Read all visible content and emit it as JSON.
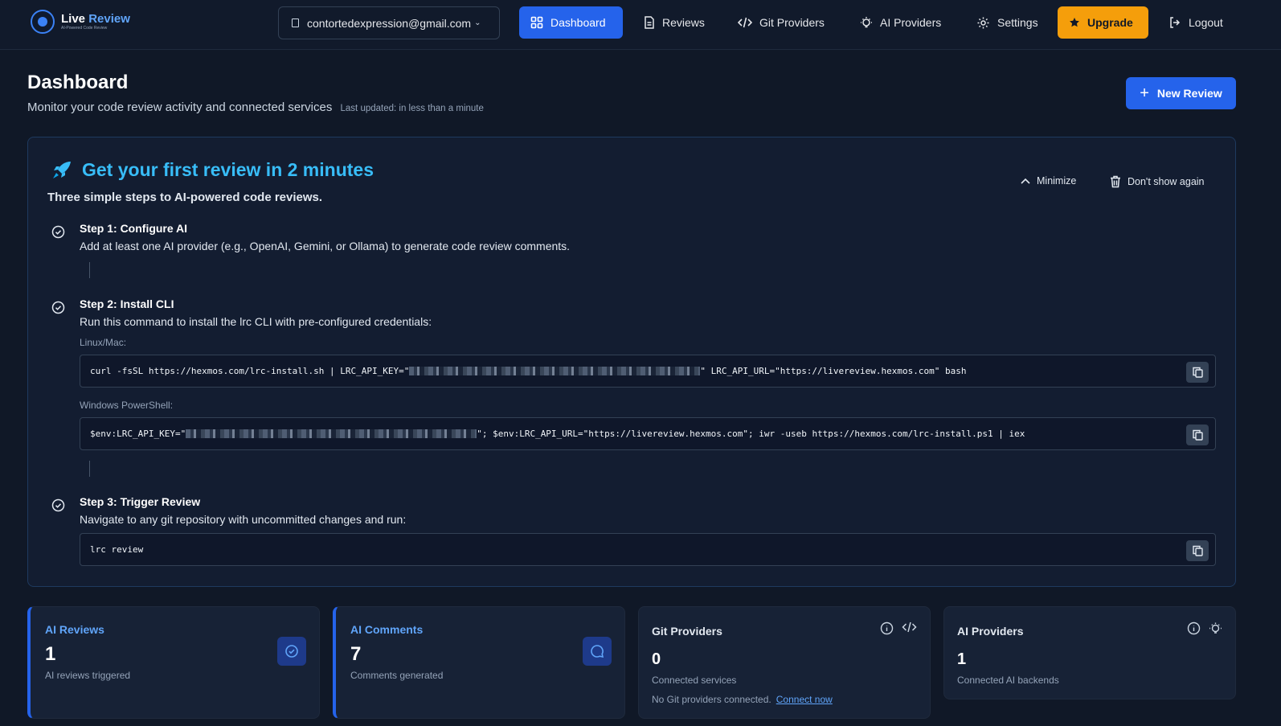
{
  "app": {
    "logo_word1": "Live",
    "logo_word2": "Review",
    "logo_tagline": "AI-Powered Code Review"
  },
  "account": {
    "email": "contortedexpression@gmail.com"
  },
  "nav": {
    "dashboard": "Dashboard",
    "reviews": "Reviews",
    "git_providers": "Git Providers",
    "ai_providers": "AI Providers",
    "settings": "Settings",
    "upgrade": "Upgrade",
    "logout": "Logout"
  },
  "header": {
    "title": "Dashboard",
    "subtitle": "Monitor your code review activity and connected services",
    "last_updated": "Last updated: in less than a minute",
    "new_review": "New Review"
  },
  "onboarding": {
    "title": "Get your first review in 2 minutes",
    "subtitle": "Three simple steps to AI-powered code reviews.",
    "minimize": "Minimize",
    "dont_show": "Don't show again",
    "step1": {
      "title": "Step 1: Configure AI",
      "desc": "Add at least one AI provider (e.g., OpenAI, Gemini, or Ollama) to generate code review comments."
    },
    "step2": {
      "title": "Step 2: Install CLI",
      "desc": "Run this command to install the lrc CLI with pre-configured credentials:",
      "linux_label": "Linux/Mac:",
      "linux_cmd_prefix": "curl -fsSL https://hexmos.com/lrc-install.sh | LRC_API_KEY=\"",
      "linux_cmd_suffix": "\" LRC_API_URL=\"https://livereview.hexmos.com\" bash",
      "windows_label": "Windows PowerShell:",
      "windows_cmd_prefix": "$env:LRC_API_KEY=\"",
      "windows_cmd_suffix": "\"; $env:LRC_API_URL=\"https://livereview.hexmos.com\"; iwr -useb https://hexmos.com/lrc-install.ps1 | iex"
    },
    "step3": {
      "title": "Step 3: Trigger Review",
      "desc": "Navigate to any git repository with uncommitted changes and run:",
      "cmd": "lrc review"
    }
  },
  "stats": {
    "ai_reviews": {
      "label": "AI Reviews",
      "value": "1",
      "caption": "AI reviews triggered"
    },
    "ai_comments": {
      "label": "AI Comments",
      "value": "7",
      "caption": "Comments generated"
    },
    "git_providers": {
      "label": "Git Providers",
      "value": "0",
      "caption": "Connected services",
      "note": "No Git providers connected.",
      "link": "Connect now"
    },
    "ai_providers": {
      "label": "AI Providers",
      "value": "1",
      "caption": "Connected AI backends"
    }
  },
  "colors": {
    "background": "#101827",
    "primary": "#2563eb",
    "upgrade": "#f59e0b",
    "title_accent": "#38bdf8"
  }
}
